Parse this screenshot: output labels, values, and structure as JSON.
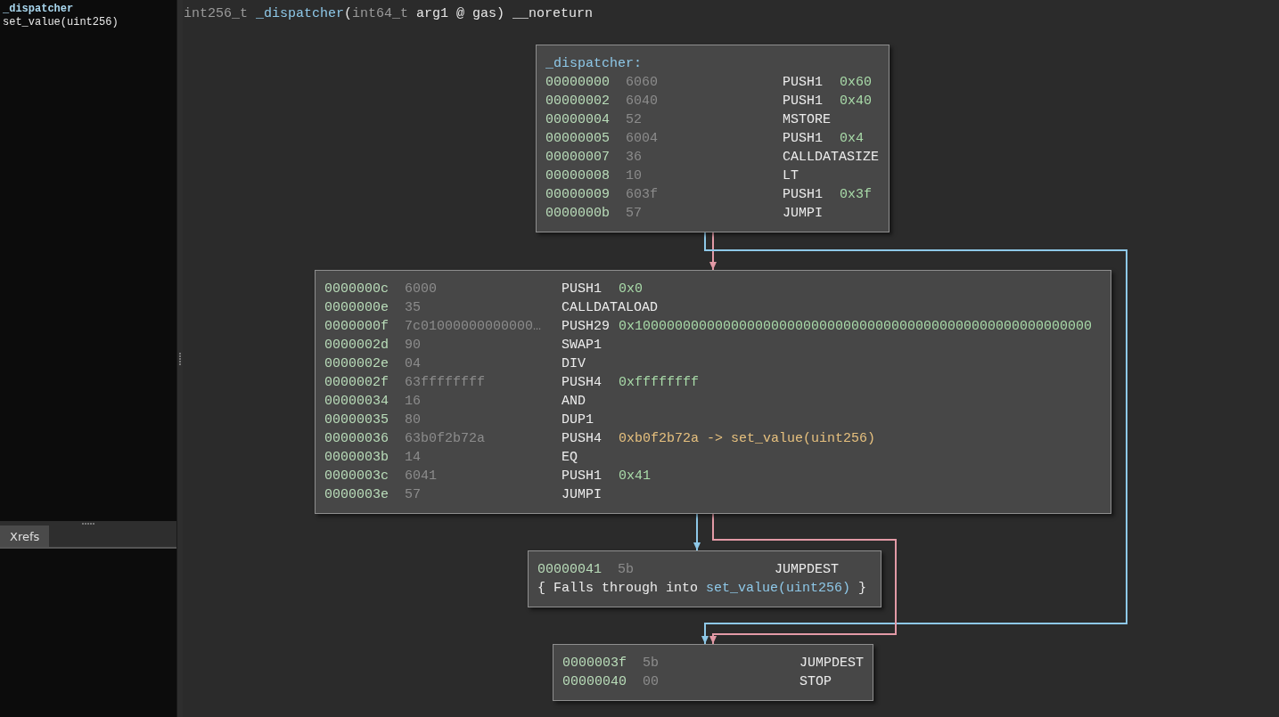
{
  "sidebar": {
    "items": [
      {
        "label": "_dispatcher",
        "selected": true
      },
      {
        "label": "set_value(uint256)",
        "selected": false
      }
    ]
  },
  "bottom_panel": {
    "tabs": [
      {
        "label": "Xrefs",
        "selected": true
      }
    ]
  },
  "signature": [
    {
      "kind": "type",
      "text": "int256_t"
    },
    {
      "kind": "name",
      "text": "_dispatcher"
    },
    {
      "kind": "plain",
      "text": "("
    },
    {
      "kind": "type",
      "text": "int64_t"
    },
    {
      "kind": "plain",
      "text": " arg1 @ gas) __noreturn"
    }
  ],
  "blocks": [
    {
      "label": "_dispatcher:",
      "lines": [
        {
          "kind": "instruction",
          "address": "00000000",
          "bytes": "6060",
          "mnemonic": "PUSH1",
          "operand": {
            "text": "0x60",
            "kind": "number"
          }
        },
        {
          "kind": "instruction",
          "address": "00000002",
          "bytes": "6040",
          "mnemonic": "PUSH1",
          "operand": {
            "text": "0x40",
            "kind": "number"
          }
        },
        {
          "kind": "instruction",
          "address": "00000004",
          "bytes": "52",
          "mnemonic": "MSTORE"
        },
        {
          "kind": "instruction",
          "address": "00000005",
          "bytes": "6004",
          "mnemonic": "PUSH1",
          "operand": {
            "text": "0x4",
            "kind": "number"
          }
        },
        {
          "kind": "instruction",
          "address": "00000007",
          "bytes": "36",
          "mnemonic": "CALLDATASIZE"
        },
        {
          "kind": "instruction",
          "address": "00000008",
          "bytes": "10",
          "mnemonic": "LT"
        },
        {
          "kind": "instruction",
          "address": "00000009",
          "bytes": "603f",
          "mnemonic": "PUSH1",
          "operand": {
            "text": "0x3f",
            "kind": "number"
          }
        },
        {
          "kind": "instruction",
          "address": "0000000b",
          "bytes": "57",
          "mnemonic": "JUMPI"
        }
      ]
    },
    {
      "lines": [
        {
          "kind": "instruction",
          "address": "0000000c",
          "bytes": "6000",
          "mnemonic": "PUSH1",
          "operand": {
            "text": "0x0",
            "kind": "number"
          }
        },
        {
          "kind": "instruction",
          "address": "0000000e",
          "bytes": "35",
          "mnemonic": "CALLDATALOAD"
        },
        {
          "kind": "instruction",
          "address": "0000000f",
          "bytes": "7c01000000000000…",
          "mnemonic": "PUSH29",
          "operand": {
            "text": "0x100000000000000000000000000000000000000000000000000000000",
            "kind": "number"
          }
        },
        {
          "kind": "instruction",
          "address": "0000002d",
          "bytes": "90",
          "mnemonic": "SWAP1"
        },
        {
          "kind": "instruction",
          "address": "0000002e",
          "bytes": "04",
          "mnemonic": "DIV"
        },
        {
          "kind": "instruction",
          "address": "0000002f",
          "bytes": "63ffffffff",
          "mnemonic": "PUSH4",
          "operand": {
            "text": "0xffffffff",
            "kind": "number"
          }
        },
        {
          "kind": "instruction",
          "address": "00000034",
          "bytes": "16",
          "mnemonic": "AND"
        },
        {
          "kind": "instruction",
          "address": "00000035",
          "bytes": "80",
          "mnemonic": "DUP1"
        },
        {
          "kind": "instruction",
          "address": "00000036",
          "bytes": "63b0f2b72a",
          "mnemonic": "PUSH4",
          "operand": {
            "text": "0xb0f2b72a -> set_value(uint256)",
            "kind": "symbol"
          }
        },
        {
          "kind": "instruction",
          "address": "0000003b",
          "bytes": "14",
          "mnemonic": "EQ"
        },
        {
          "kind": "instruction",
          "address": "0000003c",
          "bytes": "6041",
          "mnemonic": "PUSH1",
          "operand": {
            "text": "0x41",
            "kind": "number"
          }
        },
        {
          "kind": "instruction",
          "address": "0000003e",
          "bytes": "57",
          "mnemonic": "JUMPI"
        }
      ]
    },
    {
      "lines": [
        {
          "kind": "instruction",
          "address": "00000041",
          "bytes": "5b",
          "mnemonic": "JUMPDEST"
        },
        {
          "kind": "note",
          "text": "{ Falls through into ",
          "link": "set_value(uint256)",
          "suffix": " }"
        }
      ]
    },
    {
      "lines": [
        {
          "kind": "instruction",
          "address": "0000003f",
          "bytes": "5b",
          "mnemonic": "JUMPDEST"
        },
        {
          "kind": "instruction",
          "address": "00000040",
          "bytes": "00",
          "mnemonic": "STOP"
        }
      ]
    }
  ],
  "edges": [
    {
      "color": "#e39aa6"
    },
    {
      "color": "#8ec8e8"
    },
    {
      "color": "#8ec8e8"
    },
    {
      "color": "#e39aa6"
    }
  ]
}
